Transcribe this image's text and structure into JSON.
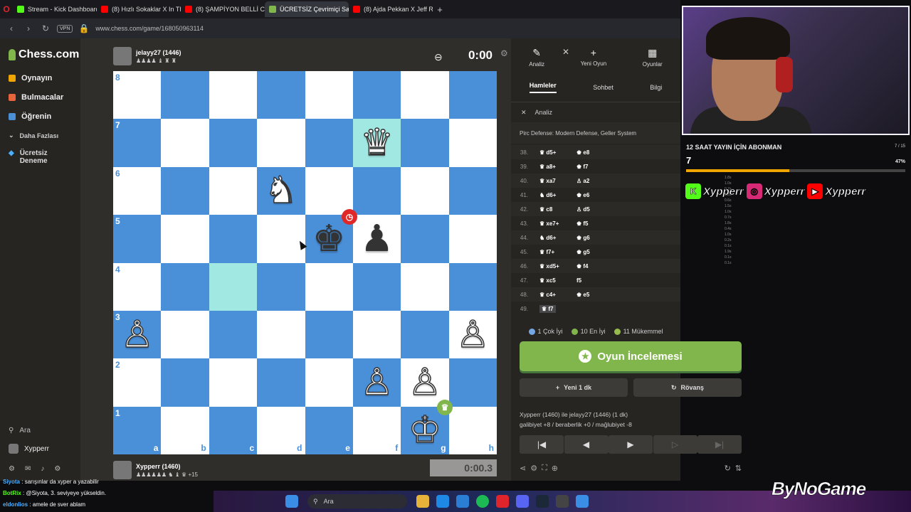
{
  "browser": {
    "tabs": [
      {
        "label": "Stream - Kick Dashboard",
        "color": "#53fc18",
        "active": false
      },
      {
        "label": "(8) Hızlı Sokaklar X In The",
        "color": "#ff0000",
        "active": false
      },
      {
        "label": "(8) ŞAMPİYON BELLİ C",
        "color": "#ff0000",
        "active": false
      },
      {
        "label": "ÜCRETSİZ Çevrimiçi Satra",
        "color": "#81b64c",
        "active": true
      },
      {
        "label": "(8) Ajda Pekkan X Jeff Red",
        "color": "#ff0000",
        "active": false
      }
    ],
    "url": "www.chess.com/game/168050963114",
    "vpn": "VPN"
  },
  "nav": {
    "logo": "Chess.com",
    "items": [
      {
        "label": "Oynayın",
        "color": "#f0a500"
      },
      {
        "label": "Bulmacalar",
        "color": "#e8643c"
      },
      {
        "label": "Öğrenin",
        "color": "#4a90d9"
      }
    ],
    "more": "Daha Fazlası",
    "premium": "Ücretsiz Deneme",
    "search": "Ara",
    "user": "Xypperr"
  },
  "game": {
    "opponent": {
      "name": "jelayy27 (1446)",
      "clock": "0:00",
      "material": "♟♟♟♟ ♝ ♜ ♜"
    },
    "player": {
      "name": "Xypperr (1460)",
      "clock": "0:00.3",
      "material": "♟♟♟♟♟♟ ♞ ♝ ♛ +15"
    },
    "files": [
      "a",
      "b",
      "c",
      "d",
      "e",
      "f",
      "g",
      "h"
    ],
    "ranks": [
      "8",
      "7",
      "6",
      "5",
      "4",
      "3",
      "2",
      "1"
    ],
    "pieces": {
      "f7": {
        "glyph": "♛",
        "side": "w"
      },
      "d6": {
        "glyph": "♞",
        "side": "w"
      },
      "e5": {
        "glyph": "♚",
        "side": "b"
      },
      "f5": {
        "glyph": "♟",
        "side": "b"
      },
      "a3": {
        "glyph": "♙",
        "side": "w"
      },
      "h3": {
        "glyph": "♙",
        "side": "w"
      },
      "f2": {
        "glyph": "♙",
        "side": "w"
      },
      "g2": {
        "glyph": "♙",
        "side": "w"
      },
      "g1": {
        "glyph": "♔",
        "side": "w"
      }
    },
    "highlights": [
      "f7",
      "c4"
    ]
  },
  "panel": {
    "tabs": [
      {
        "label": "Analiz",
        "icon": "✎"
      },
      {
        "label": "Yeni Oyun",
        "icon": "+"
      },
      {
        "label": "Oyunlar",
        "icon": "▦"
      }
    ],
    "subtabs": [
      "Hamleler",
      "Sohbet",
      "Bilgi"
    ],
    "analysis_label": "Analiz",
    "opening": "Pirc Defense: Modern Defense, Geller System",
    "moves": [
      {
        "n": "38.",
        "w": "♛ d5+",
        "b": "♚ e8"
      },
      {
        "n": "39.",
        "w": "♛ a8+",
        "b": "♚ f7"
      },
      {
        "n": "40.",
        "w": "♛ xa7",
        "b": "♙ a2"
      },
      {
        "n": "41.",
        "w": "♞ d6+",
        "b": "♚ e6"
      },
      {
        "n": "42.",
        "w": "♛ c8",
        "b": "♙ d5"
      },
      {
        "n": "43.",
        "w": "♛ xe7+",
        "b": "♚ f5"
      },
      {
        "n": "44.",
        "w": "♞ d6+",
        "b": "♚ g6"
      },
      {
        "n": "45.",
        "w": "♛ f7+",
        "b": "♚ g5"
      },
      {
        "n": "46.",
        "w": "♛ xd5+",
        "b": "♚ f4"
      },
      {
        "n": "47.",
        "w": "♛ xc5",
        "b": "f5"
      },
      {
        "n": "48.",
        "w": "♛ c4+",
        "b": "♚ e5"
      },
      {
        "n": "49.",
        "w": "♛ f7",
        "b": ""
      }
    ],
    "stats": [
      {
        "label": "1 Çok İyi",
        "color": "#74a7e6"
      },
      {
        "label": "10 En İyi",
        "color": "#81b64c"
      },
      {
        "label": "11 Mükemmel",
        "color": "#96bc4b"
      }
    ],
    "review": "Oyun İncelemesi",
    "new_game": "Yeni 1 dk",
    "rematch": "Rövanş",
    "result_line1": "Xypperr (1460) ile jelayy27 (1446) (1 dk)",
    "result_line2": "galibiyet +8 / beraberlik +0 / mağlubiyet -8"
  },
  "overlay": {
    "sub_title": "12 SAAT YAYIN İÇİN ABONMAN",
    "sub_count": "7",
    "sub_frac": "7 / 15",
    "sub_pct": "47%",
    "sub_progress": 0.47,
    "socials": [
      {
        "icon": "K",
        "handle": "Xypperr",
        "color": "#53fc18"
      },
      {
        "icon": "◎",
        "handle": "Xypperr",
        "color": "#d62976"
      },
      {
        "icon": "▶",
        "handle": "Xypperr",
        "color": "#ff0000"
      }
    ],
    "brand": "ByNoGame",
    "movetimes": [
      "1.8s",
      "1.0s",
      "0.7s",
      "1.3s",
      "0.6s",
      "1.5s",
      "1.0s",
      "0.7s",
      "1.8s",
      "0.4s",
      "1.0s",
      "0.2s",
      "0.1s",
      "1.9s",
      "0.1s",
      "0.1s"
    ]
  },
  "chat": [
    {
      "user": "Siyota",
      "msg": "sarışınlar da xyper a yazabilir",
      "color": "#4ab0ff"
    },
    {
      "user": "BotRix",
      "msg": "@Siyota, 3. seviyeye yükseldin.",
      "color": "#53fc18"
    },
    {
      "user": "eldonlios",
      "msg": "amele de sver ablam",
      "color": "#4ab0ff"
    }
  ],
  "taskbar": {
    "search": "Ara"
  }
}
